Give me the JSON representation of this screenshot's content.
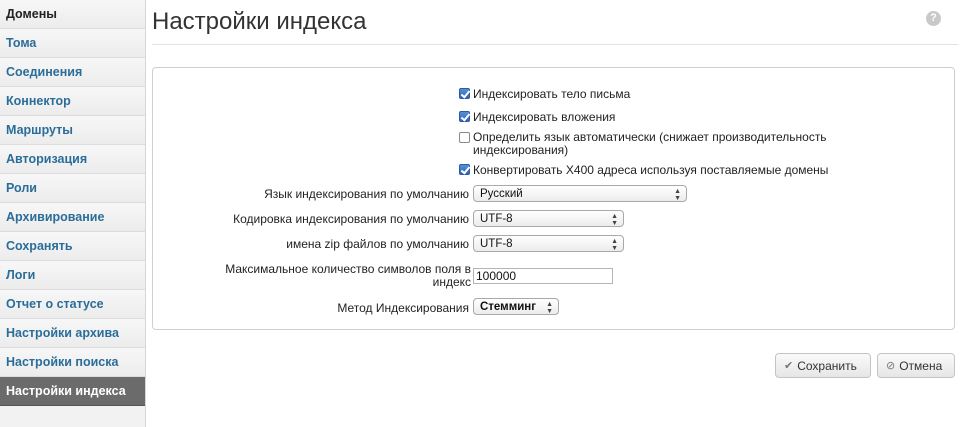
{
  "sidebar": {
    "items": [
      {
        "label": "Домены"
      },
      {
        "label": "Тома"
      },
      {
        "label": "Соединения"
      },
      {
        "label": "Коннектор"
      },
      {
        "label": "Маршруты"
      },
      {
        "label": "Авторизация"
      },
      {
        "label": "Роли"
      },
      {
        "label": "Архивирование"
      },
      {
        "label": "Сохранять"
      },
      {
        "label": "Логи"
      },
      {
        "label": "Отчет о статусе"
      },
      {
        "label": "Настройки архива"
      },
      {
        "label": "Настройки поиска"
      },
      {
        "label": "Настройки индекса"
      }
    ],
    "active_index": 13
  },
  "header": {
    "title": "Настройки индекса",
    "help_glyph": "?"
  },
  "form": {
    "checkboxes": [
      {
        "label": "Индексировать тело письма",
        "checked": true
      },
      {
        "label": "Индексировать вложения",
        "checked": true
      },
      {
        "label": "Определить язык автоматически (снижает производительность индексирования)",
        "checked": false
      },
      {
        "label": "Конвертировать X400 адреса используя поставляемые домены",
        "checked": true
      }
    ],
    "language_label": "Язык индексирования по умолчанию",
    "language_value": "Русский",
    "encoding_label": "Кодировка индексирования по умолчанию",
    "encoding_value": "UTF-8",
    "zip_label": "имена zip файлов по умолчанию",
    "zip_value": "UTF-8",
    "maxchars_label": "Максимальное количество символов поля в индекс",
    "maxchars_value": "100000",
    "method_label": "Метод Индексирования",
    "method_value": "Стемминг"
  },
  "buttons": {
    "save_label": "Сохранить",
    "cancel_label": "Отмена"
  },
  "colors": {
    "link": "#2a6d99",
    "active_bg": "#6b6b6b",
    "checkbox_checked": "#2f63b5"
  }
}
